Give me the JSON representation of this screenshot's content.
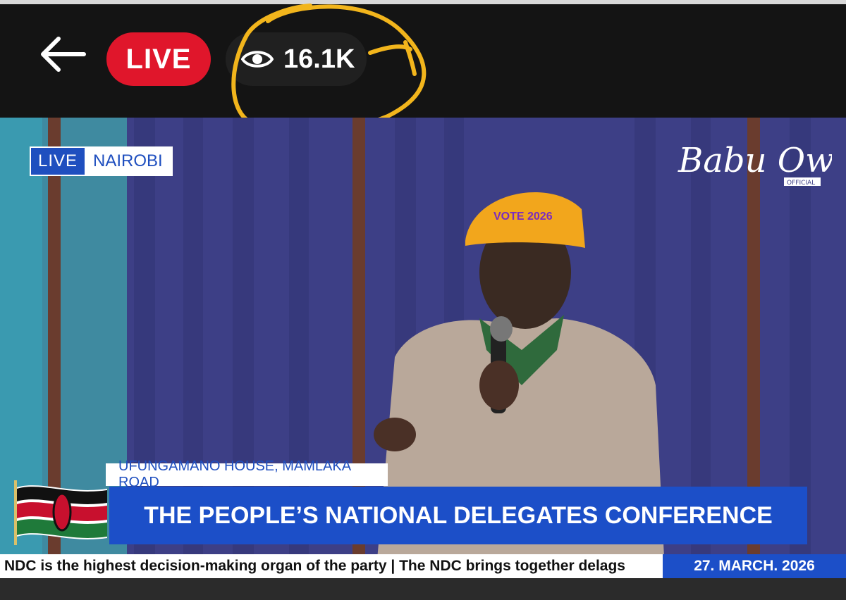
{
  "topbar": {
    "back_icon": "arrow-left-icon",
    "live_label": "LIVE",
    "viewers_icon": "eye-icon",
    "viewer_count": "16.1K"
  },
  "overlay": {
    "live_tag": "LIVE",
    "city": "NAIROBI",
    "logo_text": "Babu Owino",
    "logo_subtext": "OFFICIAL",
    "cap_text": "VOTE 2026",
    "location": "UFUNGAMANO HOUSE, MAMLAKA ROAD",
    "headline": "THE PEOPLE’S NATIONAL DELEGATES CONFERENCE",
    "ticker": "NDC is the highest decision-making organ of the party | The NDC brings together delags",
    "date": "27. MARCH. 2026"
  },
  "colors": {
    "live_red": "#e0162b",
    "broadcast_blue": "#1c4fc8",
    "highlight_yellow": "#f2b51c"
  }
}
